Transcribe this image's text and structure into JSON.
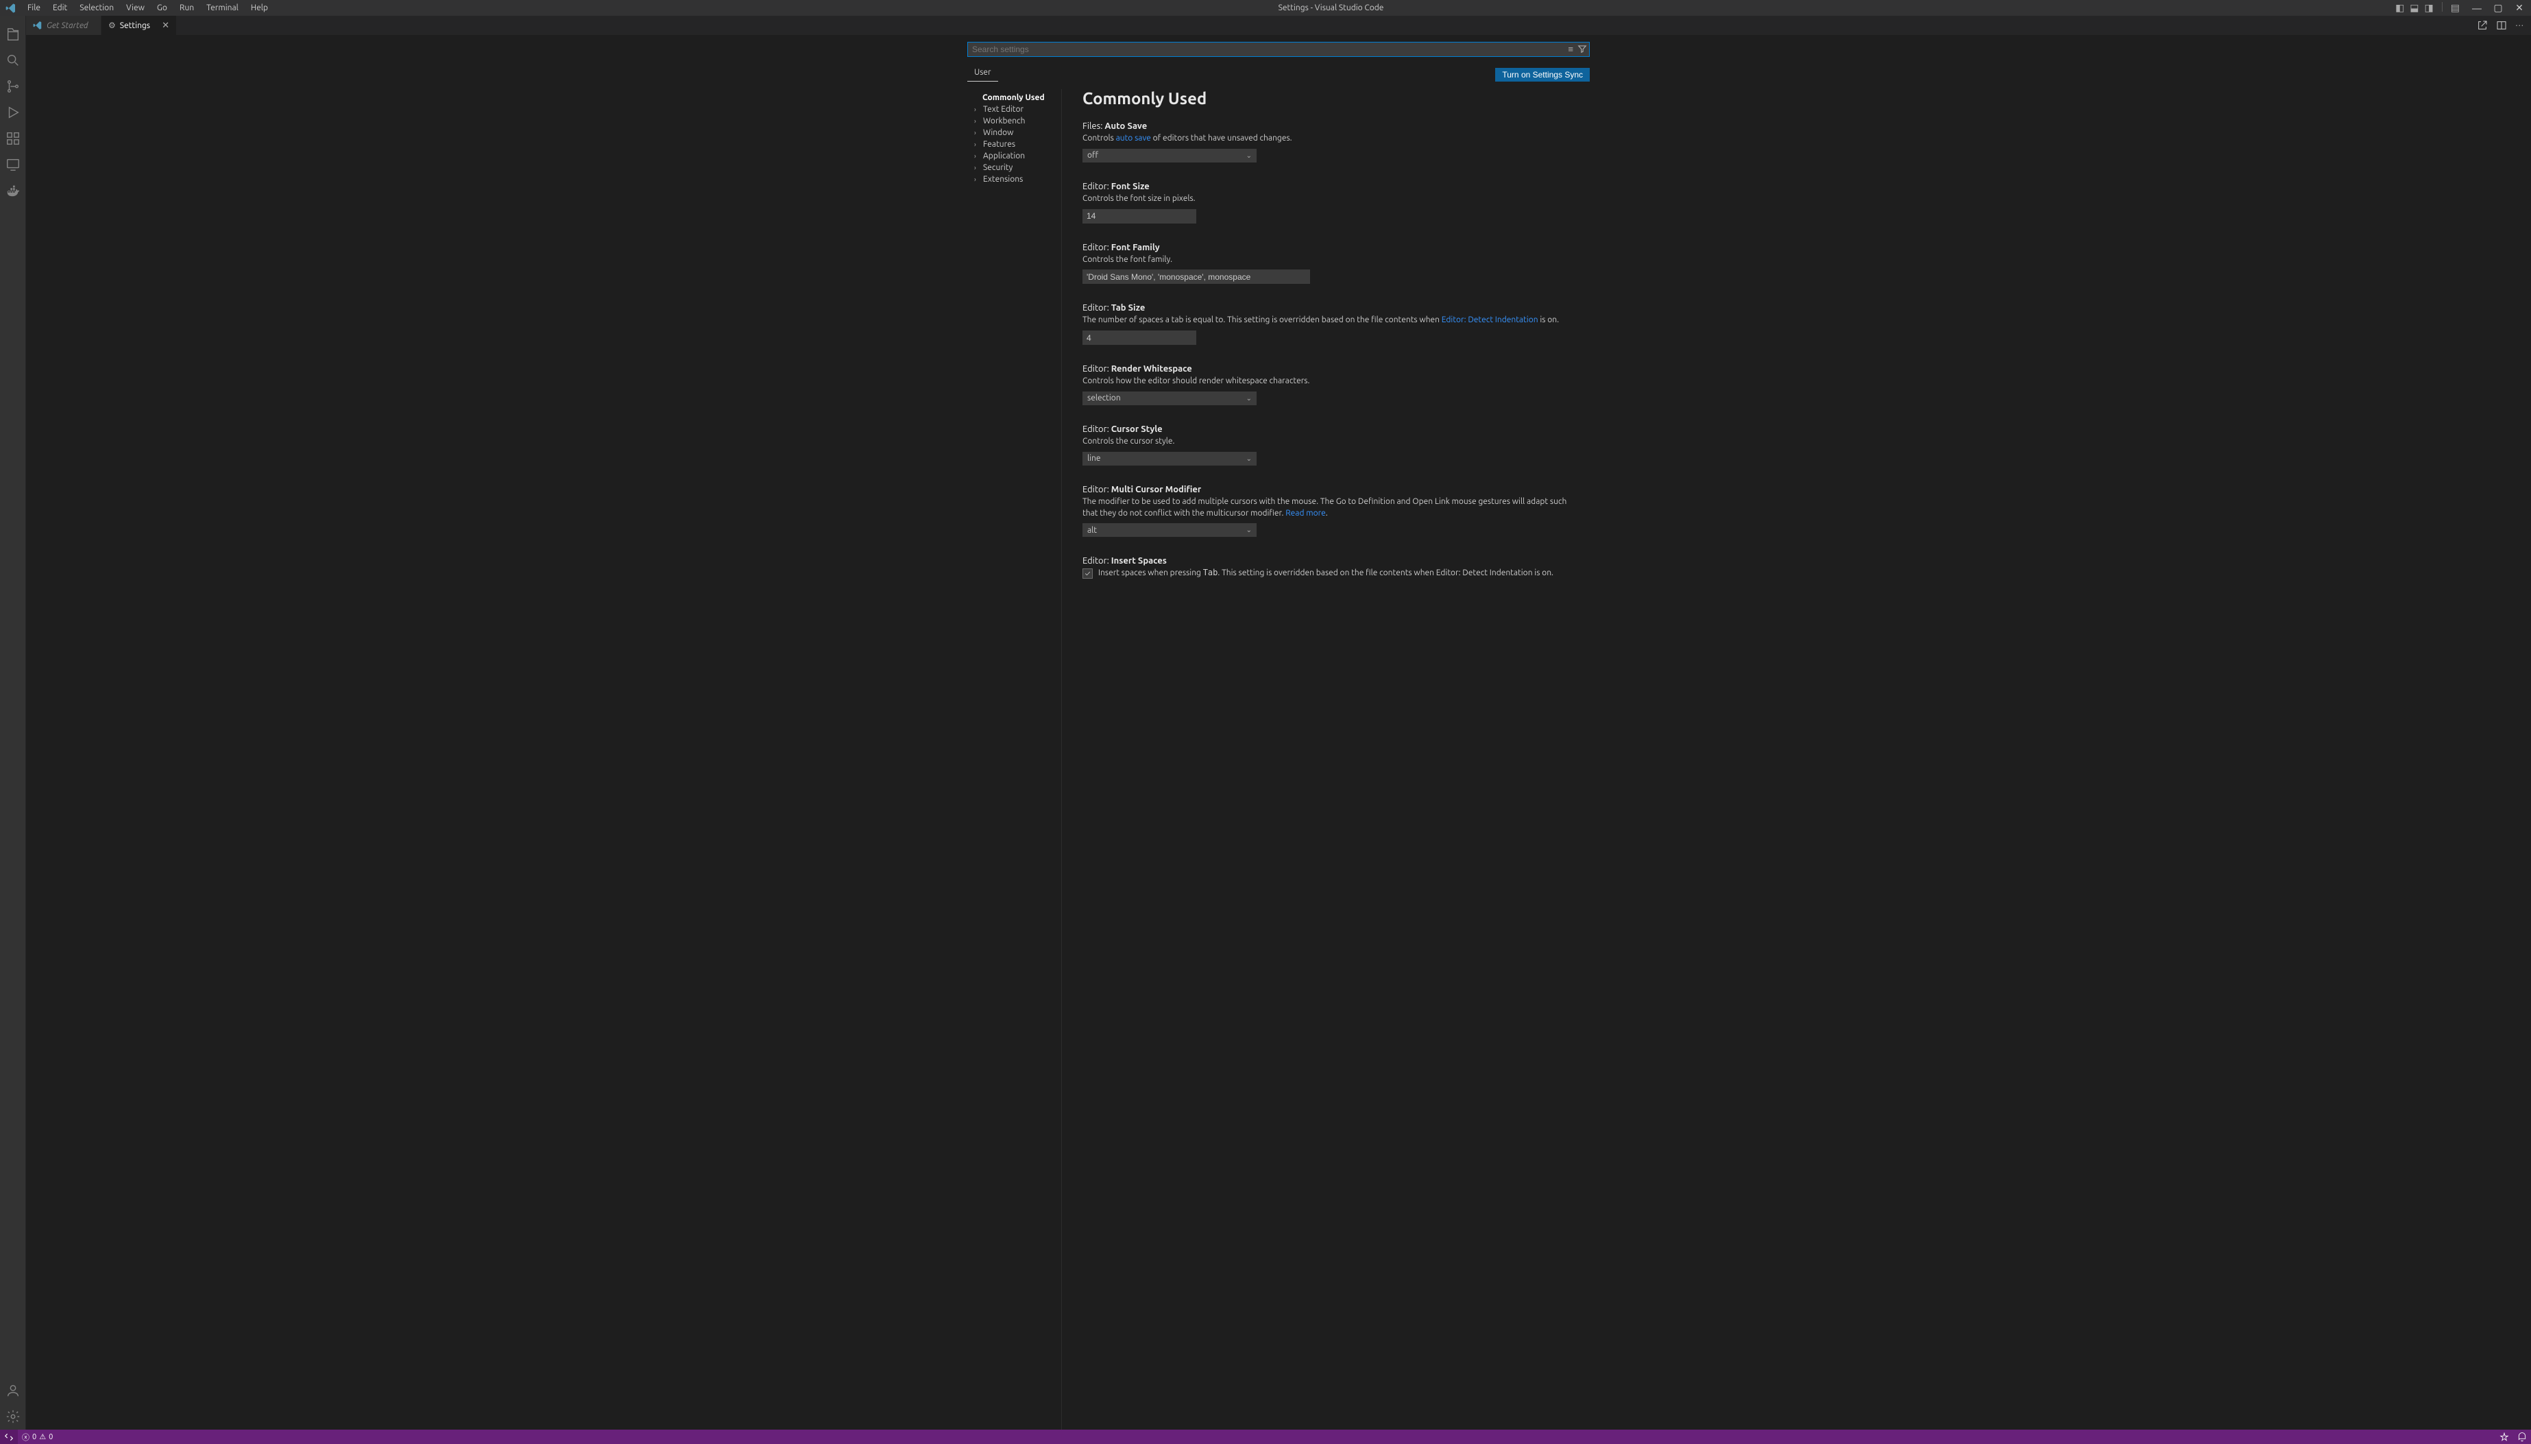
{
  "titlebar": {
    "menus": [
      "File",
      "Edit",
      "Selection",
      "View",
      "Go",
      "Run",
      "Terminal",
      "Help"
    ],
    "title": "Settings - Visual Studio Code"
  },
  "tabs": [
    {
      "label": "Get Started",
      "italic": true,
      "active": false
    },
    {
      "label": "Settings",
      "italic": false,
      "active": true
    }
  ],
  "search": {
    "placeholder": "Search settings"
  },
  "scope": {
    "tab": "User",
    "sync_button": "Turn on Settings Sync"
  },
  "toc": [
    {
      "label": "Commonly Used",
      "active": true,
      "expandable": false
    },
    {
      "label": "Text Editor",
      "active": false,
      "expandable": true
    },
    {
      "label": "Workbench",
      "active": false,
      "expandable": true
    },
    {
      "label": "Window",
      "active": false,
      "expandable": true
    },
    {
      "label": "Features",
      "active": false,
      "expandable": true
    },
    {
      "label": "Application",
      "active": false,
      "expandable": true
    },
    {
      "label": "Security",
      "active": false,
      "expandable": true
    },
    {
      "label": "Extensions",
      "active": false,
      "expandable": true
    }
  ],
  "heading": "Commonly Used",
  "settings": {
    "autosave": {
      "prefix": "Files: ",
      "name": "Auto Save",
      "desc_before": "Controls ",
      "link": "auto save",
      "desc_after": " of editors that have unsaved changes.",
      "value": "off"
    },
    "fontsize": {
      "prefix": "Editor: ",
      "name": "Font Size",
      "desc": "Controls the font size in pixels.",
      "value": "14"
    },
    "fontfamily": {
      "prefix": "Editor: ",
      "name": "Font Family",
      "desc": "Controls the font family.",
      "value": "'Droid Sans Mono', 'monospace', monospace"
    },
    "tabsize": {
      "prefix": "Editor: ",
      "name": "Tab Size",
      "desc_before": "The number of spaces a tab is equal to. This setting is overridden based on the file contents when ",
      "link": "Editor: Detect Indentation",
      "desc_after": " is on.",
      "value": "4"
    },
    "whitespace": {
      "prefix": "Editor: ",
      "name": "Render Whitespace",
      "desc": "Controls how the editor should render whitespace characters.",
      "value": "selection"
    },
    "cursorstyle": {
      "prefix": "Editor: ",
      "name": "Cursor Style",
      "desc": "Controls the cursor style.",
      "value": "line"
    },
    "multicursor": {
      "prefix": "Editor: ",
      "name": "Multi Cursor Modifier",
      "desc_before": "The modifier to be used to add multiple cursors with the mouse. The Go to Definition and Open Link mouse gestures will adapt such that they do not conflict with the multicursor modifier. ",
      "link": "Read more",
      "desc_after": ".",
      "value": "alt"
    },
    "insertspaces": {
      "prefix": "Editor: ",
      "name": "Insert Spaces",
      "desc_before": "Insert spaces when pressing ",
      "code": "Tab",
      "desc_mid": ". This setting is overridden based on the file contents when ",
      "link": "Editor: Detect Indentation",
      "desc_after": " is on.",
      "checked": true
    }
  },
  "status": {
    "errors": "0",
    "warnings": "0"
  }
}
